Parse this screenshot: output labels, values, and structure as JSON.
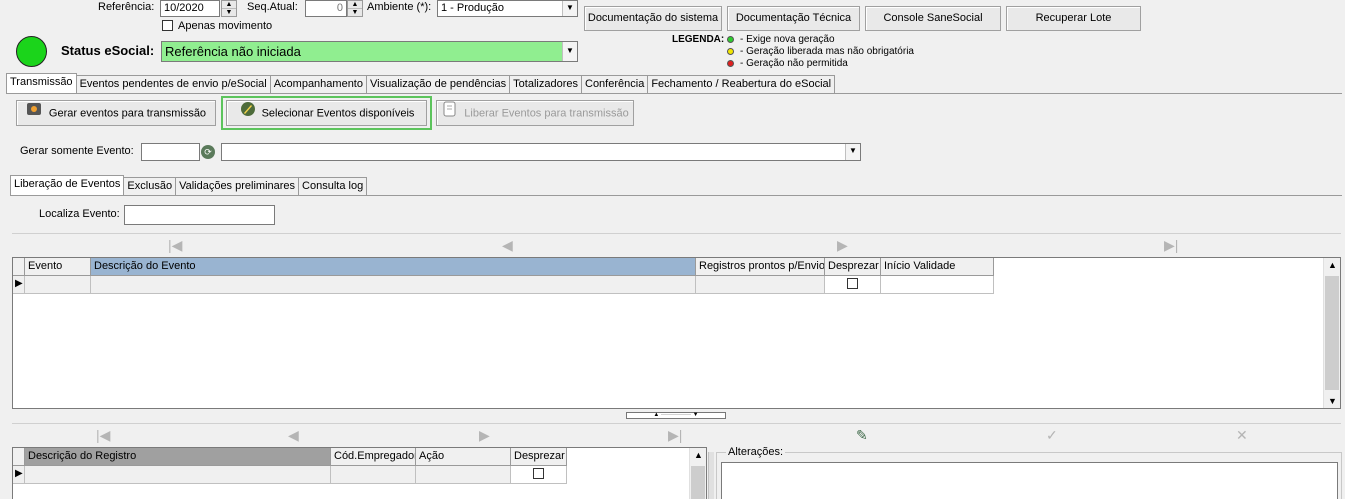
{
  "header": {
    "referencia_label": "Referência:",
    "referencia_value": "10/2020",
    "seq_label": "Seq.Atual:",
    "seq_value": "0",
    "ambiente_label": "Ambiente (*):",
    "ambiente_value": "1 - Produção",
    "apenas_movimento_label": "Apenas movimento",
    "status_label": "Status eSocial:",
    "status_value": "Referência não iniciada",
    "status_color": "#1bd41b"
  },
  "top_buttons": {
    "doc_sistema": "Documentação do sistema",
    "doc_tecnica": "Documentação Técnica",
    "console": "Console SaneSocial",
    "recuperar": "Recuperar Lote"
  },
  "legend": {
    "title": "LEGENDA:",
    "items": [
      {
        "text": "- Exige nova geração",
        "color": "#2ecc2e"
      },
      {
        "text": "- Geração liberada mas não obrigatória",
        "color": "#f2e600"
      },
      {
        "text": "- Geração não permitida",
        "color": "#e02020"
      }
    ]
  },
  "main_tabs": [
    "Transmissão",
    "Eventos pendentes de envio p/eSocial",
    "Acompanhamento",
    "Visualização de pendências",
    "Totalizadores",
    "Conferência",
    "Fechamento / Reabertura do eSocial"
  ],
  "actions": {
    "gerar": "Gerar eventos para transmissão",
    "selecionar": "Selecionar Eventos disponíveis",
    "liberar": "Liberar Eventos para transmissão"
  },
  "gerar_evento": {
    "label": "Gerar somente Evento:",
    "code_value": "",
    "select_value": ""
  },
  "sub_tabs": [
    "Liberação de Eventos",
    "Exclusão",
    "Validações preliminares",
    "Consulta log"
  ],
  "localiza": {
    "label": "Localiza Evento:",
    "value": ""
  },
  "events_grid": {
    "columns": [
      "Evento",
      "Descrição do Evento",
      "Registros prontos p/Envio",
      "Desprezar",
      "Início Validade"
    ]
  },
  "records_grid": {
    "columns": [
      "Descrição do Registro",
      "Cód.Empregador",
      "Ação",
      "Desprezar"
    ]
  },
  "alteracoes": {
    "label": "Alterações:"
  }
}
